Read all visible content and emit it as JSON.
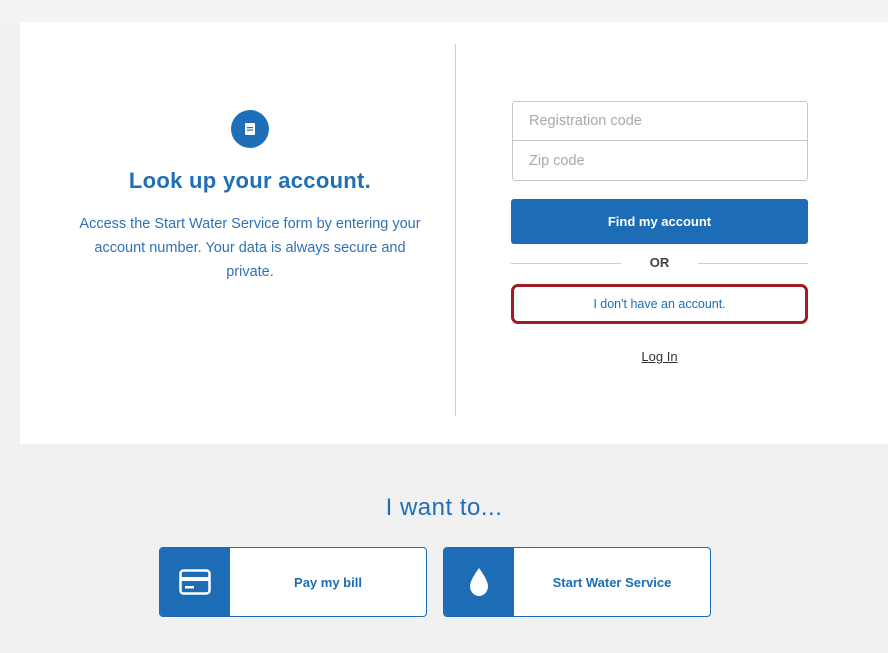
{
  "lookup": {
    "icon": "document-icon",
    "title": "Look up your account.",
    "description": "Access the Start Water Service form by entering your account number. Your data is always secure and private."
  },
  "form": {
    "registration_placeholder": "Registration code",
    "zip_placeholder": "Zip code",
    "registration_value": "",
    "zip_value": "",
    "find_button": "Find my account",
    "or_text": "OR",
    "no_account_button": "I don't have an account.",
    "login_link": "Log In"
  },
  "want": {
    "title": "I want to...",
    "tiles": [
      {
        "label": "Pay my bill",
        "icon": "credit-card-icon"
      },
      {
        "label": "Start Water Service",
        "icon": "water-drop-icon"
      }
    ]
  },
  "colors": {
    "primary_blue": "#1c6db5",
    "highlight_red": "#a11c22",
    "background": "#f1f1f1"
  }
}
